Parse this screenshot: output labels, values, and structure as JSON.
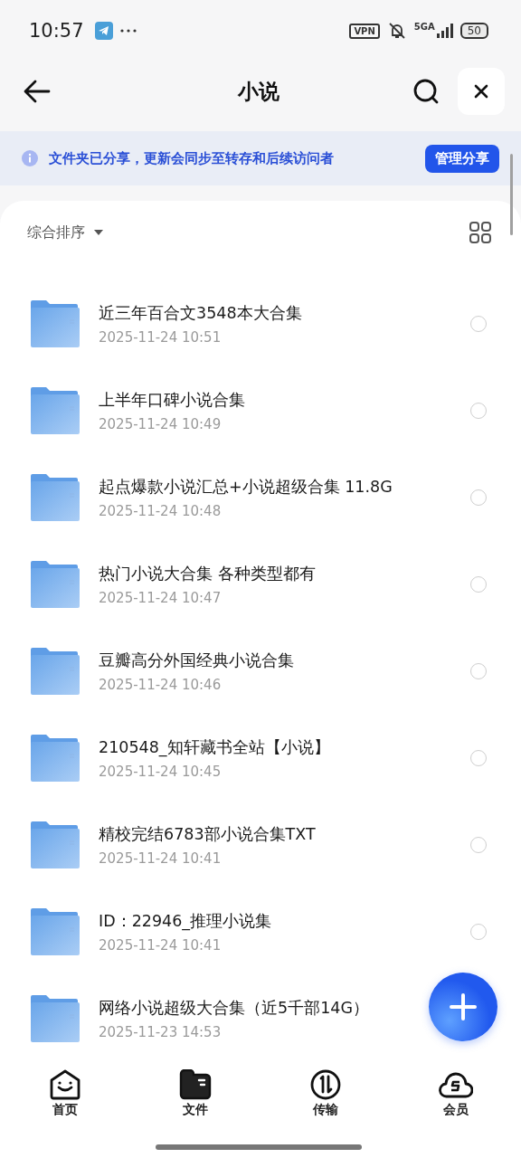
{
  "status_bar": {
    "time": "10:57",
    "vpn": "VPN",
    "network": "5GA",
    "battery": "50"
  },
  "header": {
    "title": "小说"
  },
  "banner": {
    "text": "文件夹已分享，更新会同步至转存和后续访问者",
    "button": "管理分享"
  },
  "sort": {
    "label": "综合排序"
  },
  "files": [
    {
      "name": "近三年百合文3548本大合集",
      "date": "2025-11-24 10:51",
      "selected": false
    },
    {
      "name": "上半年口碑小说合集",
      "date": "2025-11-24 10:49",
      "selected": false
    },
    {
      "name": "起点爆款小说汇总+小说超级合集 11.8G",
      "date": "2025-11-24 10:48",
      "selected": false
    },
    {
      "name": "热门小说大合集 各种类型都有",
      "date": "2025-11-24 10:47",
      "selected": false
    },
    {
      "name": "豆瓣高分外国经典小说合集",
      "date": "2025-11-24 10:46",
      "selected": false
    },
    {
      "name": "210548_知轩藏书全站【小说】",
      "date": "2025-11-24 10:45",
      "selected": false
    },
    {
      "name": "精校完结6783部小说合集TXT",
      "date": "2025-11-24 10:41",
      "selected": false
    },
    {
      "name": "ID：22946_推理小说集",
      "date": "2025-11-24 10:41",
      "selected": false
    },
    {
      "name": "网络小说超级大合集（近5千部14G）",
      "date": "2025-11-23 14:53",
      "selected": false
    }
  ],
  "nav": [
    {
      "kind": "home",
      "label": "首页",
      "selected": false
    },
    {
      "kind": "files",
      "label": "文件",
      "selected": true
    },
    {
      "kind": "transfer",
      "label": "传输",
      "selected": false
    },
    {
      "kind": "member",
      "label": "会员",
      "selected": false
    }
  ]
}
